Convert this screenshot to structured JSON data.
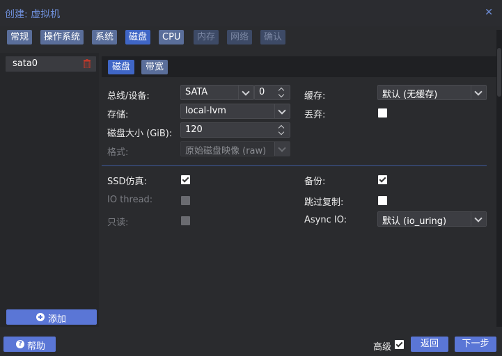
{
  "window": {
    "title": "创建: 虚拟机"
  },
  "wizard_tabs": [
    {
      "label": "常规",
      "state": "normal"
    },
    {
      "label": "操作系统",
      "state": "normal"
    },
    {
      "label": "系统",
      "state": "normal"
    },
    {
      "label": "磁盘",
      "state": "active"
    },
    {
      "label": "CPU",
      "state": "normal"
    },
    {
      "label": "内存",
      "state": "disabled"
    },
    {
      "label": "网络",
      "state": "disabled"
    },
    {
      "label": "确认",
      "state": "disabled"
    }
  ],
  "disk_list": {
    "items": [
      {
        "label": "sata0"
      }
    ],
    "add_label": "添加"
  },
  "sub_tabs": [
    {
      "label": "磁盘"
    },
    {
      "label": "带宽"
    }
  ],
  "form": {
    "bus_label": "总线/设备:",
    "bus_value": "SATA",
    "device_index": "0",
    "storage_label": "存储:",
    "storage_value": "local-lvm",
    "size_label": "磁盘大小 (GiB):",
    "size_value": "120",
    "format_label": "格式:",
    "format_value": "原始磁盘映像 (raw)",
    "cache_label": "缓存:",
    "cache_value": "默认 (无缓存)",
    "discard_label": "丢弃:",
    "discard_checked": false,
    "ssd_label": "SSD仿真:",
    "ssd_checked": true,
    "iothread_label": "IO thread:",
    "readonly_label": "只读:",
    "backup_label": "备份:",
    "backup_checked": true,
    "skip_replication_label": "跳过复制:",
    "skip_replication_checked": false,
    "async_io_label": "Async IO:",
    "async_io_value": "默认 (io_uring)"
  },
  "footer": {
    "help_label": "帮助",
    "advanced_label": "高级",
    "advanced_checked": true,
    "back_label": "返回",
    "next_label": "下一步"
  },
  "colors": {
    "accent": "#5a76d6",
    "tab_active": "#3f66c6",
    "delete": "#c0392b"
  }
}
